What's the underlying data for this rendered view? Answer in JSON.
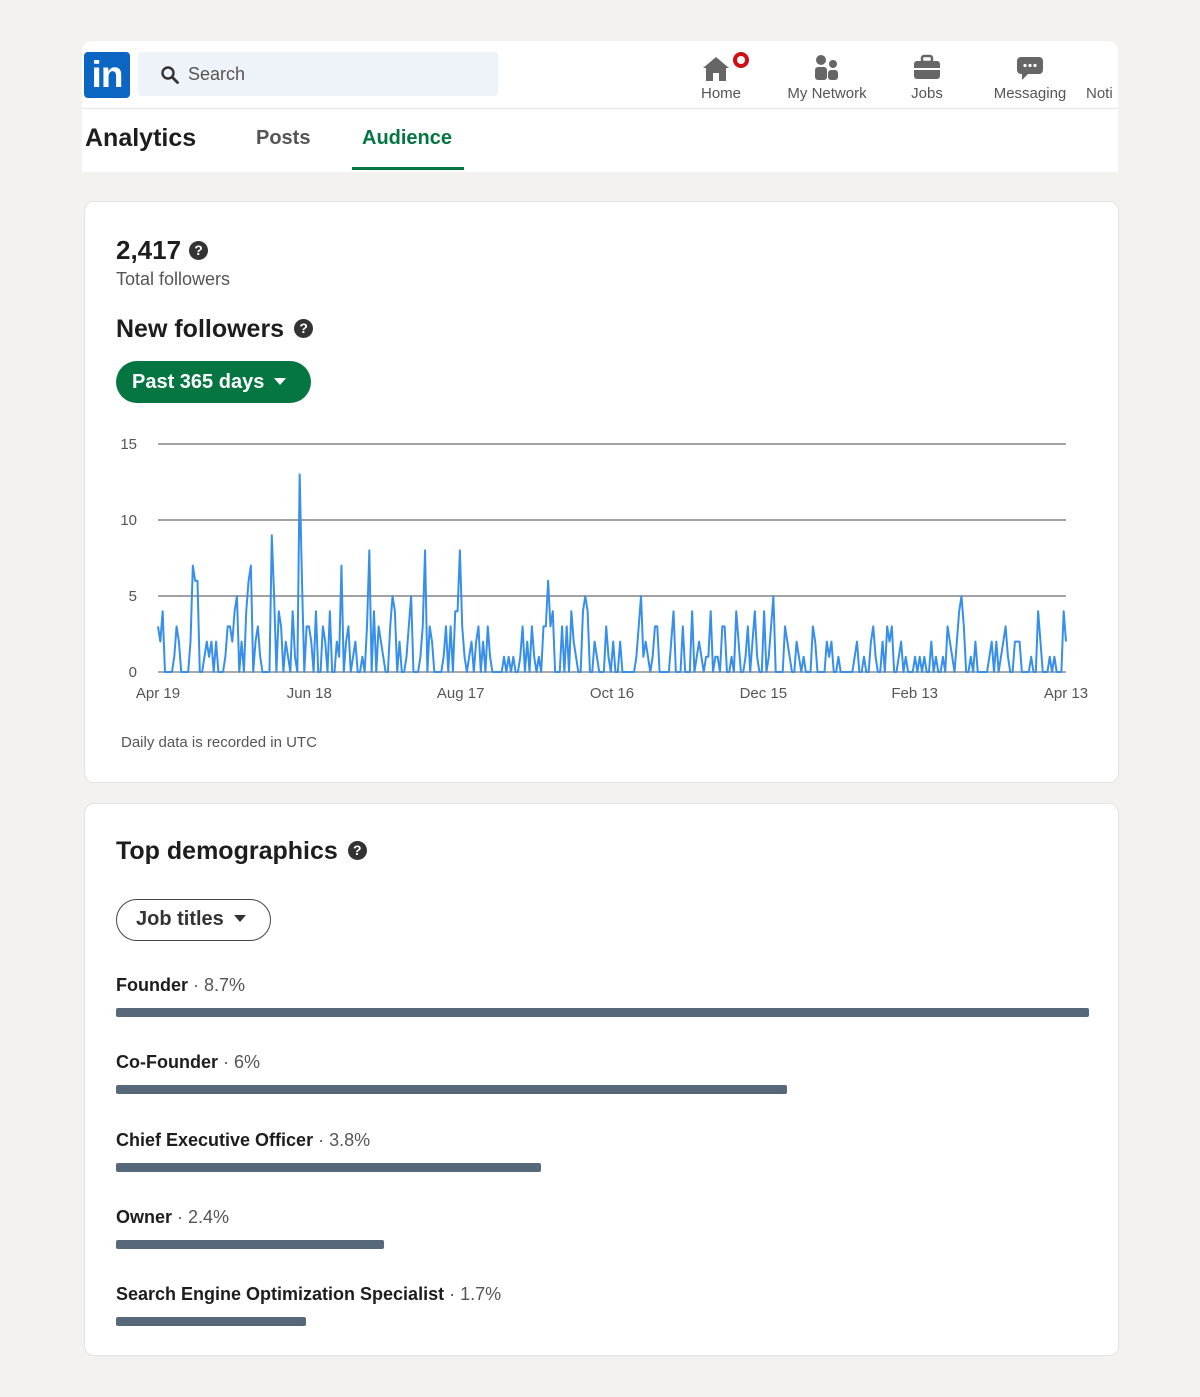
{
  "nav": {
    "logo_text": "in",
    "search_placeholder": "Search",
    "items": [
      {
        "label": "Home",
        "icon": "home-icon"
      },
      {
        "label": "My Network",
        "icon": "people-icon"
      },
      {
        "label": "Jobs",
        "icon": "briefcase-icon"
      },
      {
        "label": "Messaging",
        "icon": "chat-icon"
      },
      {
        "label": "Noti",
        "icon": "bell-icon"
      }
    ]
  },
  "tabs": {
    "title": "Analytics",
    "items": [
      "Posts",
      "Audience"
    ],
    "active": "Audience"
  },
  "followers": {
    "count": "2,417",
    "label": "Total followers",
    "new_title": "New followers",
    "range_label": "Past 365 days",
    "note": "Daily data is recorded in UTC"
  },
  "chart_data": {
    "type": "line",
    "x_ticks": [
      "Apr 19",
      "Jun 18",
      "Aug 17",
      "Oct 16",
      "Dec 15",
      "Feb 13",
      "Apr 13"
    ],
    "y_ticks": [
      0,
      5,
      10,
      15
    ],
    "ylim": [
      0,
      15
    ],
    "grid": true,
    "color": "#378fe9",
    "values": [
      3,
      2,
      4,
      0,
      0,
      0,
      0,
      1,
      3,
      2,
      0,
      0,
      0,
      0,
      2,
      7,
      6,
      6,
      0,
      0,
      1,
      2,
      1,
      2,
      0,
      2,
      0,
      0,
      0,
      1,
      3,
      3,
      2,
      4,
      5,
      0,
      2,
      0,
      4,
      6,
      7,
      0,
      2,
      3,
      1,
      0,
      0,
      0,
      0,
      9,
      5,
      0,
      4,
      3,
      0,
      2,
      1,
      0,
      4,
      1,
      0,
      13,
      6,
      0,
      3,
      3,
      2,
      0,
      4,
      0,
      0,
      3,
      2,
      0,
      4,
      0,
      0,
      2,
      1,
      7,
      0,
      2,
      3,
      0,
      1,
      2,
      0,
      0,
      1,
      0,
      3,
      8,
      0,
      4,
      0,
      3,
      2,
      1,
      0,
      0,
      3,
      5,
      4,
      0,
      2,
      0,
      0,
      1,
      3,
      5,
      0,
      0,
      0,
      1,
      3,
      8,
      0,
      3,
      2,
      0,
      0,
      0,
      0,
      1,
      3,
      0,
      3,
      0,
      4,
      4,
      8,
      3,
      1,
      0,
      1,
      2,
      0,
      2,
      3,
      0,
      2,
      0,
      3,
      1,
      0,
      0,
      0,
      0,
      0,
      1,
      0,
      1,
      0,
      1,
      0,
      0,
      1,
      3,
      0,
      2,
      0,
      3,
      1,
      0,
      1,
      0,
      3,
      3,
      6,
      3,
      4,
      0,
      0,
      0,
      3,
      0,
      3,
      0,
      4,
      2,
      1,
      0,
      0,
      4,
      5,
      4,
      0,
      0,
      2,
      1,
      0,
      0,
      0,
      3,
      1,
      0,
      2,
      0,
      0,
      2,
      0,
      0,
      0,
      0,
      0,
      0,
      1,
      3,
      5,
      1,
      2,
      1,
      0,
      1,
      3,
      3,
      0,
      0,
      0,
      0,
      0,
      2,
      4,
      0,
      0,
      0,
      3,
      0,
      0,
      0,
      4,
      0,
      1,
      2,
      1,
      0,
      1,
      1,
      4,
      0,
      1,
      1,
      0,
      3,
      3,
      0,
      0,
      1,
      0,
      4,
      2,
      0,
      0,
      1,
      3,
      0,
      2,
      4,
      1,
      0,
      0,
      4,
      0,
      1,
      3,
      5,
      0,
      0,
      0,
      0,
      3,
      2,
      1,
      0,
      0,
      2,
      1,
      0,
      1,
      0,
      0,
      0,
      3,
      2,
      0,
      0,
      0,
      0,
      2,
      1,
      2,
      0,
      0,
      1,
      0,
      0,
      0,
      0,
      0,
      0,
      1,
      2,
      0,
      0,
      1,
      0,
      0,
      2,
      3,
      1,
      0,
      0,
      2,
      0,
      3,
      2,
      3,
      0,
      0,
      1,
      2,
      0,
      1,
      0,
      0,
      0,
      1,
      0,
      1,
      0,
      1,
      0,
      0,
      2,
      0,
      1,
      0,
      0,
      1,
      0,
      3,
      2,
      1,
      0,
      2,
      4,
      5,
      3,
      0,
      0,
      1,
      0,
      2,
      0,
      0,
      0,
      0,
      0,
      1,
      2,
      0,
      2,
      0,
      1,
      2,
      3,
      1,
      0,
      0,
      2,
      2,
      2,
      0,
      0,
      0,
      0,
      1,
      0,
      0,
      4,
      2,
      0,
      0,
      0,
      1,
      0,
      1,
      0,
      0,
      0,
      4,
      2
    ]
  },
  "demographics": {
    "title": "Top demographics",
    "filter_label": "Job titles",
    "bar_color": "#56687a",
    "items": [
      {
        "name": "Founder",
        "pct_label": "8.7%",
        "pct": 8.7
      },
      {
        "name": "Co-Founder",
        "pct_label": "6%",
        "pct": 6
      },
      {
        "name": "Chief Executive Officer",
        "pct_label": "3.8%",
        "pct": 3.8
      },
      {
        "name": "Owner",
        "pct_label": "2.4%",
        "pct": 2.4
      },
      {
        "name": "Search Engine Optimization Specialist",
        "pct_label": "1.7%",
        "pct": 1.7
      }
    ]
  }
}
